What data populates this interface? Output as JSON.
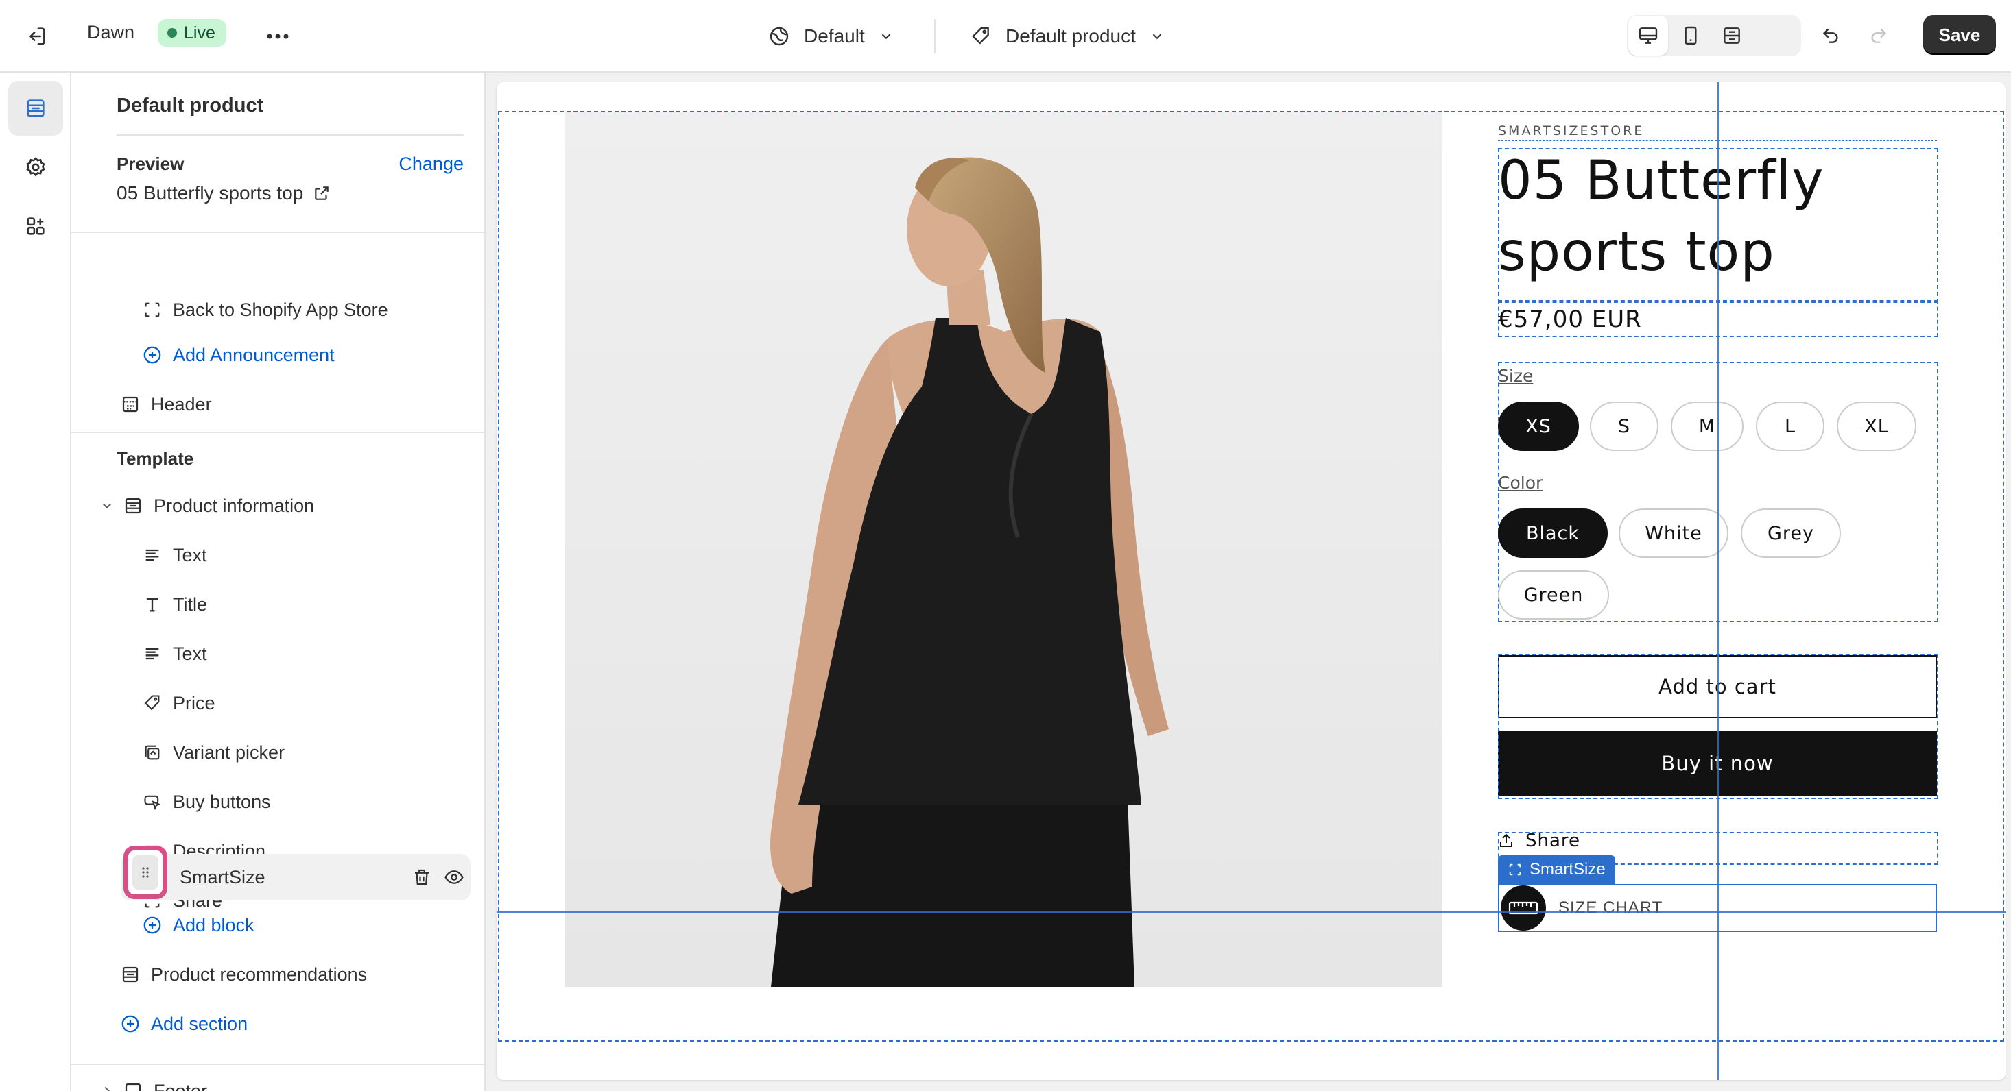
{
  "topbar": {
    "theme_name": "Dawn",
    "status": "Live",
    "theme_preset": "Default",
    "template": "Default product",
    "save_label": "Save"
  },
  "sidebar": {
    "title": "Default product",
    "preview_label": "Preview",
    "change_label": "Change",
    "preview_value": "05 Butterfly sports top",
    "partial_item": "Back to Shopify App Store",
    "add_announcement": "Add Announcement",
    "header": "Header",
    "template_label": "Template",
    "section": "Product information",
    "blocks": [
      "Text",
      "Title",
      "Text",
      "Price",
      "Variant picker",
      "Buy buttons",
      "Description",
      "Share",
      "SmartSize"
    ],
    "add_block": "Add block",
    "product_recommendations": "Product recommendations",
    "add_section": "Add section",
    "footer_partial": "Footer"
  },
  "product": {
    "vendor": "SMARTSIZESTORE",
    "title": "05 Butterfly sports top",
    "price": "€57,00 EUR",
    "size_label": "Size",
    "sizes": [
      "XS",
      "S",
      "M",
      "L",
      "XL"
    ],
    "selected_size": "XS",
    "color_label": "Color",
    "colors": [
      "Black",
      "White",
      "Grey",
      "Green"
    ],
    "selected_color": "Black",
    "add_to_cart": "Add to cart",
    "buy_now": "Buy it now",
    "share": "Share"
  },
  "smartsize": {
    "tag": "SmartSize",
    "widget_text": "SIZE CHART"
  },
  "colors": {
    "accent": "#2c6ecb",
    "link": "#005bd3",
    "live_bg": "#c8f5d3",
    "highlight": "#d64f86",
    "dark": "#121212"
  }
}
